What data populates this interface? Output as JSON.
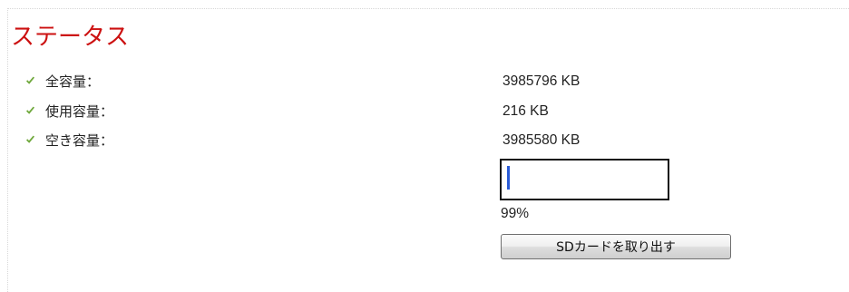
{
  "header": {
    "title": "ステータス"
  },
  "status": {
    "rows": [
      {
        "label": "全容量：",
        "value": "3985796 KB",
        "icon": "check-icon"
      },
      {
        "label": "使用容量：",
        "value": "216 KB",
        "icon": "check-icon"
      },
      {
        "label": "空き容量：",
        "value": "3985580 KB",
        "icon": "check-icon"
      }
    ],
    "used_fraction": 0.01,
    "percent_text": "99%"
  },
  "actions": {
    "eject_label": "SDカードを取り出す"
  },
  "colors": {
    "title": "#cc1111",
    "check": "#6fa83c",
    "bar": "#2a5bd7"
  }
}
